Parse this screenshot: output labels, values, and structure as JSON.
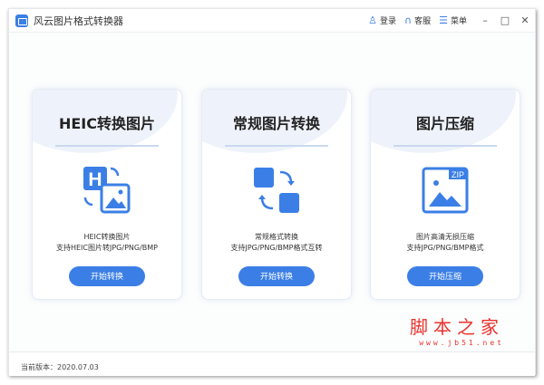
{
  "window": {
    "title": "风云图片格式转换器"
  },
  "toolbar": {
    "login": "登录",
    "service": "客服",
    "menu": "菜单",
    "minimize": "–",
    "maximize": "□",
    "close": "✕"
  },
  "cards": [
    {
      "title": "HEIC转换图片",
      "line1": "HEIC转换图片",
      "line2": "支持HEIC图片转JPG/PNG/BMP",
      "button": "开始转换"
    },
    {
      "title": "常规图片转换",
      "line1": "常规格式转换",
      "line2": "支持JPG/PNG/BMP格式互转",
      "button": "开始转换"
    },
    {
      "title": "图片压缩",
      "line1": "图片高清无损压缩",
      "line2": "支持JPG/PNG/BMP格式",
      "button": "开始压缩",
      "zip_label": "ZIP"
    }
  ],
  "watermark": {
    "name": "脚本之家",
    "url": "www.jb51.net"
  },
  "footer": {
    "version": "当前版本：2020.07.03"
  },
  "colors": {
    "accent": "#3b7fe6"
  }
}
